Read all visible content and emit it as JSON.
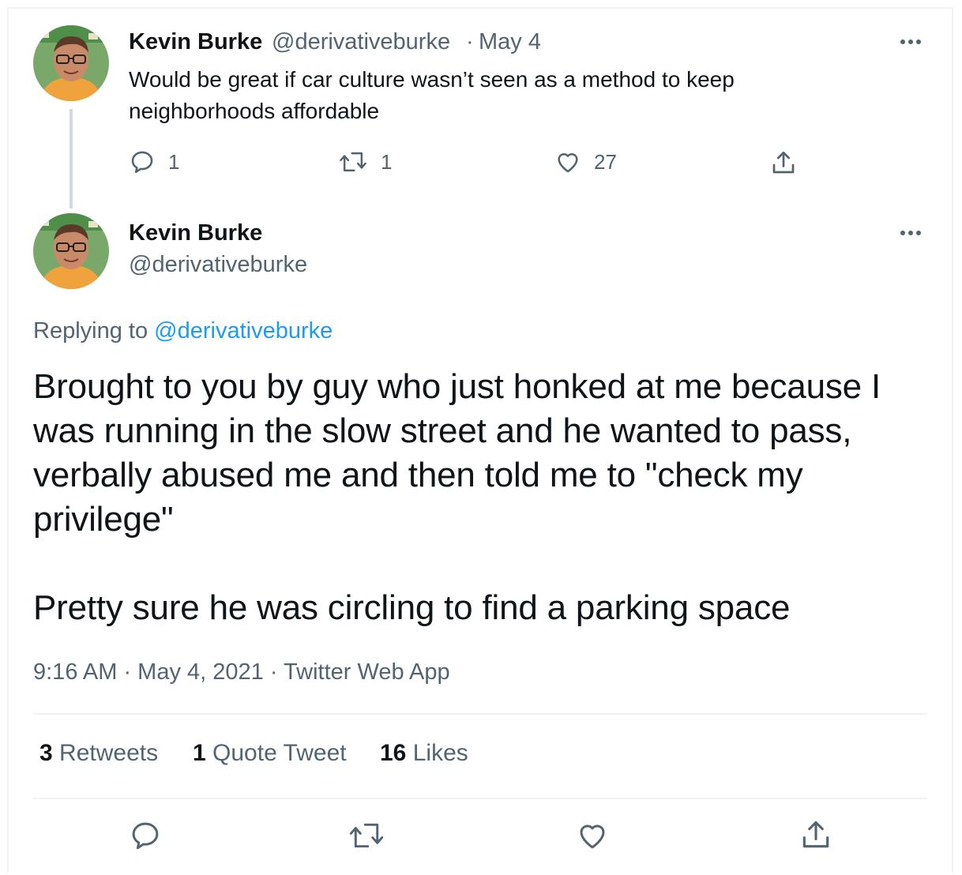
{
  "parent_tweet": {
    "author_name": "Kevin Burke",
    "handle": "@derivativeburke",
    "separator": "·",
    "date": "May 4",
    "text_line1": "Would be great if car culture wasn’t seen as a method to keep",
    "text_line2": "neighborhoods affordable",
    "reply_count": "1",
    "retweet_count": "1",
    "like_count": "27"
  },
  "main_tweet": {
    "author_name": "Kevin Burke",
    "handle": "@derivativeburke",
    "replying_prefix": "Replying to",
    "replying_handle": "@derivativeburke",
    "paragraph1": "Brought to you by guy who just honked at me because I\nwas running in the slow street and he wanted to pass,\nverbally abused me and then told me to \"check my\nprivilege\"",
    "paragraph2": "Pretty sure he was circling to find a parking space",
    "meta": "9:16 AM · May 4, 2021 · Twitter Web App"
  },
  "stats": {
    "retweets_count": "3",
    "retweets_label": "Retweets",
    "quotes_count": "1",
    "quotes_label": "Quote Tweet",
    "likes_count": "16",
    "likes_label": "Likes"
  },
  "icons": {
    "reply": "reply-icon",
    "retweet": "retweet-icon",
    "like": "heart-icon",
    "share": "share-icon",
    "more": "more-icon"
  },
  "colors": {
    "text": "#0f1419",
    "muted": "#536471",
    "link": "#1d9bf0",
    "border": "#eff3f4"
  }
}
